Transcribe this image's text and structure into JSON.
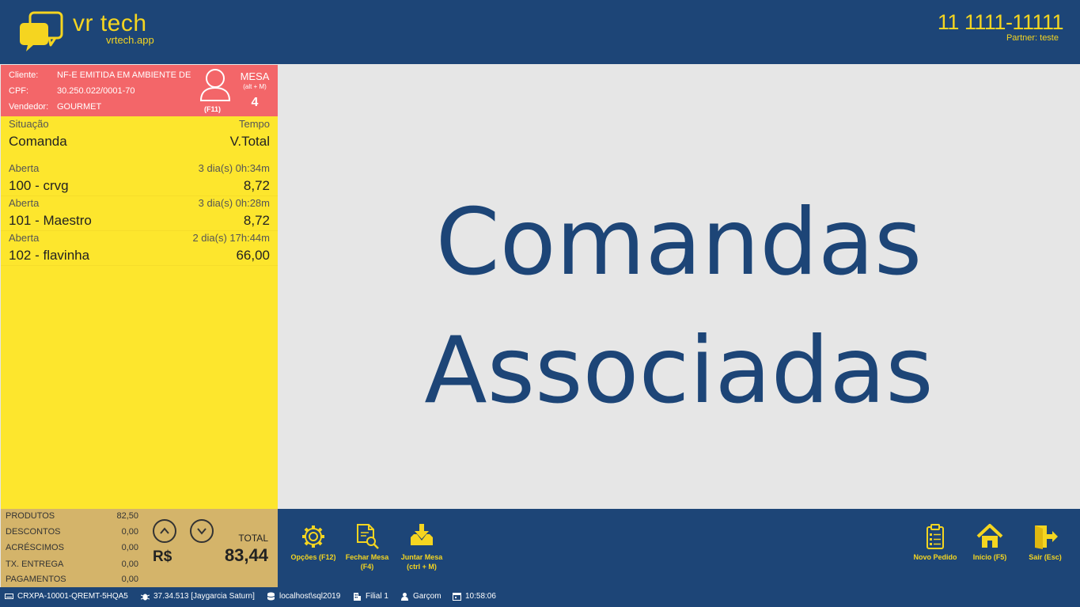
{
  "header": {
    "brand": "vr tech",
    "brand_sub": "vrtech.app",
    "phone": "11 1111-11111",
    "partner": "Partner: teste"
  },
  "client": {
    "cliente_label": "Cliente:",
    "cliente_value": "NF-E EMITIDA EM AMBIENTE DE",
    "cpf_label": "CPF:",
    "cpf_value": "30.250.022/0001-70",
    "vendedor_label": "Vendedor:",
    "vendedor_value": "GOURMET",
    "f11": "(F11)",
    "mesa_label": "MESA",
    "mesa_hint": "(alt + M)",
    "mesa_number": "4"
  },
  "list": {
    "head": {
      "situacao": "Situação",
      "tempo": "Tempo",
      "comanda": "Comanda",
      "vtotal": "V.Total"
    },
    "rows": [
      {
        "status": "Aberta",
        "time": "3 dia(s) 0h:34m",
        "name": "100 - crvg",
        "value": "8,72"
      },
      {
        "status": "Aberta",
        "time": "3 dia(s) 0h:28m",
        "name": "101 - Maestro",
        "value": "8,72"
      },
      {
        "status": "Aberta",
        "time": "2 dia(s) 17h:44m",
        "name": "102 - flavinha",
        "value": "66,00"
      }
    ]
  },
  "totals": {
    "produtos_label": "PRODUTOS",
    "produtos_value": "82,50",
    "descontos_label": "DESCONTOS",
    "descontos_value": "0,00",
    "acrescimos_label": "ACRÉSCIMOS",
    "acrescimos_value": "0,00",
    "entrega_label": "TX. ENTREGA",
    "entrega_value": "0,00",
    "pagamentos_label": "PAGAMENTOS",
    "pagamentos_value": "0,00",
    "currency": "R$",
    "total_label": "TOTAL",
    "total_value": "83,44"
  },
  "main": {
    "title_line1": "Comandas",
    "title_line2": "Associadas"
  },
  "toolbar": {
    "opcoes": "Opções (F12)",
    "fechar_line1": "Fechar Mesa",
    "fechar_line2": "(F4)",
    "juntar_line1": "Juntar Mesa",
    "juntar_line2": "(ctrl + M)",
    "novo_pedido": "Novo Pedido",
    "inicio": "Início (F5)",
    "sair": "Sair (Esc)"
  },
  "status": {
    "terminal": "CRXPA-10001-QREMT-5HQA5",
    "version": "37.34.513 [Jaygarcia Saturn]",
    "database": "localhost\\sql2019",
    "filial": "Filial 1",
    "user": "Garçom",
    "clock": "10:58:06"
  },
  "colors": {
    "navy": "#1d4577",
    "accent_yellow": "#f5d520",
    "client_red": "#f36669",
    "list_yellow": "#fde62d",
    "totals_tan": "#d4b46a"
  }
}
